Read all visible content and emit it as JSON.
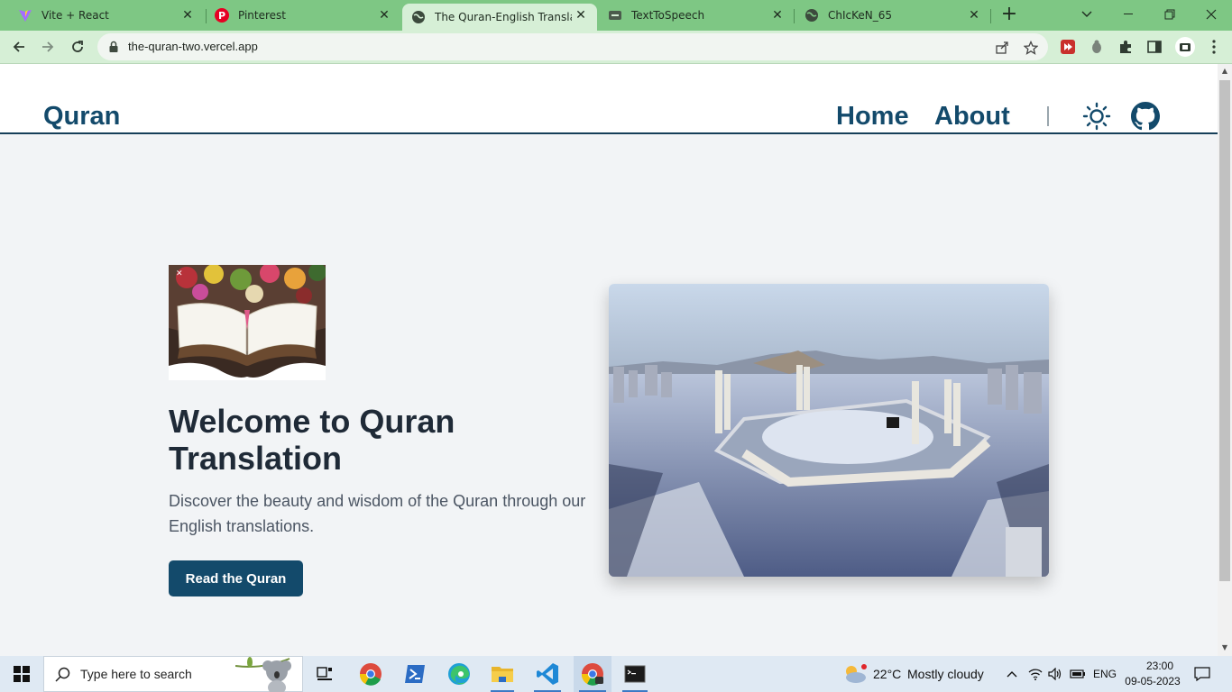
{
  "browser": {
    "tabs": [
      {
        "title": "Vite + React",
        "active": false
      },
      {
        "title": "Pinterest",
        "active": false
      },
      {
        "title": "The Quran-English Translatio",
        "active": true
      },
      {
        "title": "TextToSpeech",
        "active": false
      },
      {
        "title": "ChIcKeN_65",
        "active": false
      }
    ],
    "url": "the-quran-two.vercel.app"
  },
  "site": {
    "brand": "Quran",
    "nav": {
      "home": "Home",
      "about": "About"
    },
    "hero": {
      "title": "Welcome to Quran Translation",
      "description": "Discover the beauty and wisdom of the Quran through our English translations.",
      "cta": "Read the Quran"
    },
    "accent_color": "#134a6b"
  },
  "taskbar": {
    "search_placeholder": "Type here to search",
    "weather": {
      "temp": "22°C",
      "condition": "Mostly cloudy"
    },
    "language": "ENG",
    "time": "23:00",
    "date": "09-05-2023"
  }
}
